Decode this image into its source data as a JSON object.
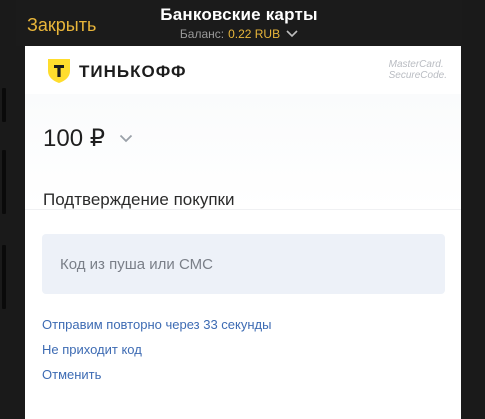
{
  "header": {
    "close_label": "Закрыть",
    "title": "Банковские карты",
    "balance_label": "Баланс:",
    "balance_value": "0.22 RUB"
  },
  "brand": {
    "logo_text": "ТИНЬКОФФ",
    "mc_line1": "MasterCard.",
    "mc_line2": "SecureCode."
  },
  "payment": {
    "amount": "100 ₽"
  },
  "confirmation": {
    "title": "Подтверждение покупки",
    "code_placeholder": "Код из пуша или СМС",
    "code_value": ""
  },
  "links": {
    "resend": "Отправим повторно через 33 секунды",
    "no_code": "Не приходит код",
    "cancel": "Отменить"
  },
  "colors": {
    "accent": "#e8b53a",
    "link": "#3d6bb3",
    "input_bg": "#edf1f8",
    "brand_yellow": "#ffdd2d"
  }
}
